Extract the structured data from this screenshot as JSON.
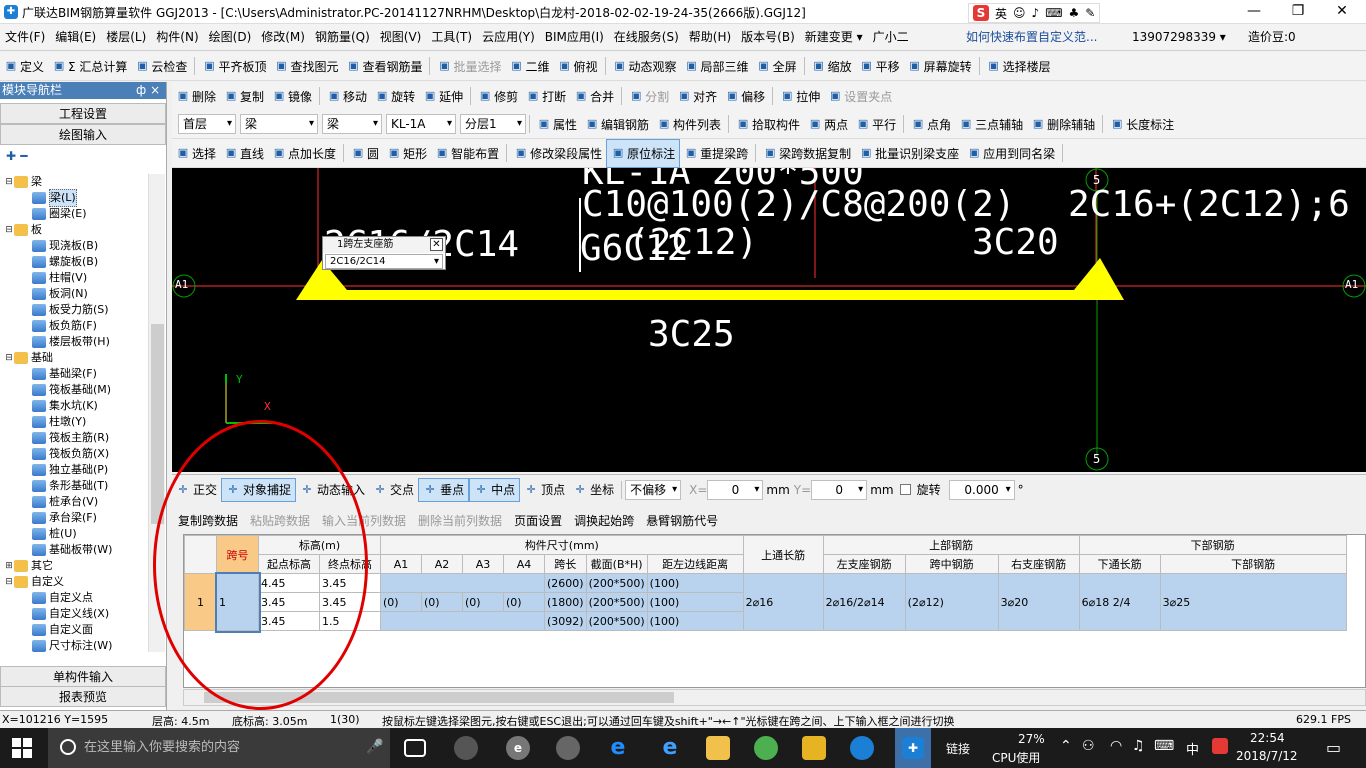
{
  "window": {
    "app_icon": "✚",
    "title": "广联达BIM钢筋算量软件 GGJ2013 - [C:\\Users\\Administrator.PC-20141127NRHM\\Desktop\\白龙村-2018-02-02-19-24-35(2666版).GGJ12]",
    "ime_mode": "英",
    "ime_logo": "S",
    "minimize": "—",
    "restore": "❐",
    "close": "✕"
  },
  "menubar": {
    "items": [
      "文件(F)",
      "编辑(E)",
      "楼层(L)",
      "构件(N)",
      "绘图(D)",
      "修改(M)",
      "钢筋量(Q)",
      "视图(V)",
      "工具(T)",
      "云应用(Y)",
      "BIM应用(I)",
      "在线服务(S)",
      "帮助(H)",
      "版本号(B)",
      "新建变更 ▾",
      "广小二"
    ],
    "help_link": "如何快速布置自定义范...",
    "phone": "13907298339 ▾",
    "price": "造价豆:0"
  },
  "toolbar1": {
    "items": [
      "定义",
      "Σ 汇总计算",
      "云检查",
      "平齐板顶",
      "查找图元",
      "查看钢筋量",
      "批量选择",
      "二维",
      "俯视",
      "动态观察",
      "局部三维",
      "全屏",
      "缩放",
      "平移",
      "屏幕旋转",
      "选择楼层"
    ]
  },
  "toolbar2": {
    "items": [
      "删除",
      "复制",
      "镜像",
      "移动",
      "旋转",
      "延伸",
      "修剪",
      "打断",
      "合并",
      "分割",
      "对齐",
      "偏移",
      "拉伸",
      "设置夹点"
    ]
  },
  "toolbar3": {
    "floor": "首层",
    "type1": "梁",
    "type2": "梁",
    "name": "KL-1A",
    "layer": "分层1",
    "items": [
      "属性",
      "编辑钢筋",
      "构件列表",
      "拾取构件",
      "两点",
      "平行",
      "点角",
      "三点辅轴",
      "删除辅轴",
      "长度标注"
    ]
  },
  "toolbar4": {
    "items": [
      "选择",
      "直线",
      "点加长度",
      "圆",
      "矩形",
      "智能布置",
      "修改梁段属性",
      "原位标注",
      "重提梁跨",
      "梁跨数据复制",
      "批量识别梁支座",
      "应用到同名梁"
    ]
  },
  "left": {
    "header": "模块导航栏",
    "pin": "ф ×",
    "btn1": "工程设置",
    "btn2": "绘图输入",
    "btn_bottom1": "单构件输入",
    "btn_bottom2": "报表预览"
  },
  "tree": [
    {
      "t": "梁",
      "k": "folder",
      "lv": 0,
      "tg": "⊟"
    },
    {
      "t": "梁(L)",
      "k": "leaf",
      "lv": 1,
      "sel": true
    },
    {
      "t": "圈梁(E)",
      "k": "leaf",
      "lv": 1
    },
    {
      "t": "板",
      "k": "folder",
      "lv": 0,
      "tg": "⊟"
    },
    {
      "t": "现浇板(B)",
      "k": "leaf",
      "lv": 1
    },
    {
      "t": "螺旋板(B)",
      "k": "leaf",
      "lv": 1
    },
    {
      "t": "柱帽(V)",
      "k": "leaf",
      "lv": 1
    },
    {
      "t": "板洞(N)",
      "k": "leaf",
      "lv": 1
    },
    {
      "t": "板受力筋(S)",
      "k": "leaf",
      "lv": 1
    },
    {
      "t": "板负筋(F)",
      "k": "leaf",
      "lv": 1
    },
    {
      "t": "楼层板带(H)",
      "k": "leaf",
      "lv": 1
    },
    {
      "t": "基础",
      "k": "folder",
      "lv": 0,
      "tg": "⊟"
    },
    {
      "t": "基础梁(F)",
      "k": "leaf",
      "lv": 1
    },
    {
      "t": "筏板基础(M)",
      "k": "leaf",
      "lv": 1
    },
    {
      "t": "集水坑(K)",
      "k": "leaf",
      "lv": 1
    },
    {
      "t": "柱墩(Y)",
      "k": "leaf",
      "lv": 1
    },
    {
      "t": "筏板主筋(R)",
      "k": "leaf",
      "lv": 1
    },
    {
      "t": "筏板负筋(X)",
      "k": "leaf",
      "lv": 1
    },
    {
      "t": "独立基础(P)",
      "k": "leaf",
      "lv": 1
    },
    {
      "t": "条形基础(T)",
      "k": "leaf",
      "lv": 1
    },
    {
      "t": "桩承台(V)",
      "k": "leaf",
      "lv": 1
    },
    {
      "t": "承台梁(F)",
      "k": "leaf",
      "lv": 1
    },
    {
      "t": "桩(U)",
      "k": "leaf",
      "lv": 1
    },
    {
      "t": "基础板带(W)",
      "k": "leaf",
      "lv": 1
    },
    {
      "t": "其它",
      "k": "folder",
      "lv": 0,
      "tg": "⊞"
    },
    {
      "t": "自定义",
      "k": "folder",
      "lv": 0,
      "tg": "⊟"
    },
    {
      "t": "自定义点",
      "k": "leaf",
      "lv": 1
    },
    {
      "t": "自定义线(X)",
      "k": "leaf",
      "lv": 1
    },
    {
      "t": "自定义面",
      "k": "leaf",
      "lv": 1
    },
    {
      "t": "尺寸标注(W)",
      "k": "leaf",
      "lv": 1
    }
  ],
  "canvas": {
    "top_text": "KL-1A 200*500",
    "stirrup": "C10@100(2)/C8@200(2)",
    "top_bars": "2C16+(2C12);6",
    "left_text": "2C16/2C14",
    "g_text": "G6C12",
    "mid": "(2C12)",
    "right_top": "3C20",
    "bottom": "3C25",
    "axis_a": "A1",
    "axis_5": "5",
    "x": "X",
    "y": "Y",
    "popup_title": "1跨左支座筋",
    "popup_value": "2C16/2C14",
    "popup_close": "✕"
  },
  "snapbar": {
    "items": [
      "正交",
      "对象捕捉",
      "动态输入",
      "交点",
      "垂点",
      "中点",
      "顶点",
      "坐标"
    ],
    "offset": "不偏移",
    "x_label": "X=",
    "x_val": "0",
    "mm1": "mm",
    "y_label": "Y=",
    "y_val": "0",
    "mm2": "mm",
    "rotate": "旋转",
    "rotate_val": "0.000",
    "deg": "°"
  },
  "gridtb": {
    "items": [
      "复制跨数据",
      "粘贴跨数据",
      "输入当前列数据",
      "删除当前列数据",
      "页面设置",
      "调换起始跨",
      "悬臂钢筋代号"
    ]
  },
  "grid": {
    "h1": [
      "跨号",
      "标高(m)",
      "构件尺寸(mm)",
      "上通长筋",
      "上部钢筋",
      "下部钢筋"
    ],
    "h2": [
      "起点标高",
      "终点标高",
      "A1",
      "A2",
      "A3",
      "A4",
      "跨长",
      "截面(B*H)",
      "距左边线距离",
      "左支座钢筋",
      "跨中钢筋",
      "右支座钢筋",
      "下通长筋",
      "下部钢筋"
    ],
    "row_no": "1",
    "span": "1",
    "r1": [
      "4.45",
      "3.45",
      "",
      "",
      "",
      "",
      "(2600)",
      "(200*500)",
      "(100)"
    ],
    "r2": [
      "3.45",
      "3.45",
      "(0)",
      "(0)",
      "(0)",
      "(0)",
      "(1800)",
      "(200*500)",
      "(100)"
    ],
    "r3": [
      "3.45",
      "1.5",
      "",
      "",
      "",
      "",
      "(3092)",
      "(200*500)",
      "(100)"
    ],
    "top_through": "2⌀16",
    "left_sup": "2⌀16/2⌀14",
    "mid_bars": "(2⌀12)",
    "right_sup": "3⌀20",
    "bottom_through": "6⌀18 2/4",
    "bottom_bars": "3⌀25"
  },
  "status": {
    "coord": "X=101216 Y=1595",
    "floor_h": "层高: 4.5m",
    "base_h": "底标高: 3.05m",
    "count": "1(30)",
    "hint": "按鼠标左键选择梁图元,按右键或ESC退出;可以通过回车键及shift+\"→←↑\"光标键在跨之间、上下输入框之间进行切换",
    "fps": "629.1 FPS"
  },
  "taskbar": {
    "search": "在这里输入你要搜索的内容",
    "link": "链接",
    "cpu_pct": "27%",
    "cpu_label": "CPU使用",
    "lang": "中",
    "time": "22:54",
    "date": "2018/7/12"
  },
  "colors": {
    "beam": "#ffff00",
    "axis": "#ff3030",
    "axis_green": "#00a000",
    "highlight": "#b9d3ee",
    "circle": "#e00000"
  }
}
